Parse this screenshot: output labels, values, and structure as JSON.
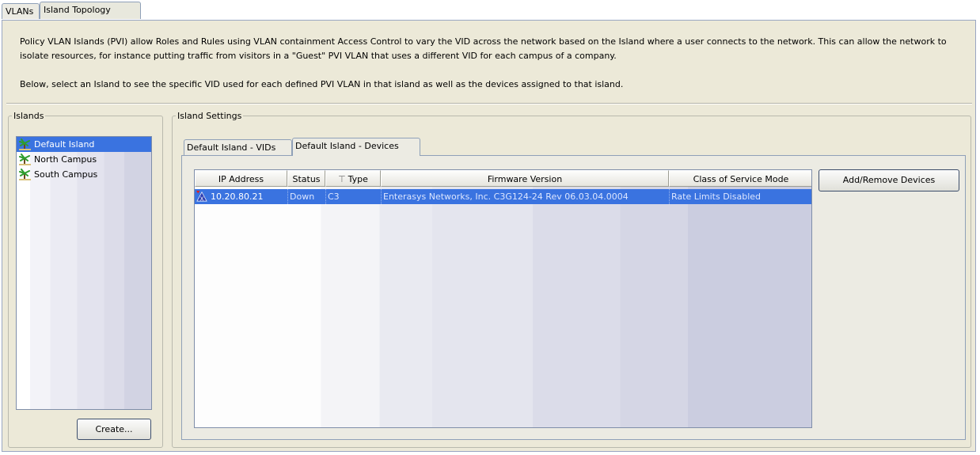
{
  "tabs": [
    {
      "label": "VLANs"
    },
    {
      "label": "Island Topology"
    }
  ],
  "description": {
    "line1": "Policy VLAN Islands (PVI) allow Roles and Rules using VLAN containment Access Control to vary the VID across the network based on the Island where a user connects to the network.  This can allow the network to isolate resources, for instance putting traffic from visitors in a \"Guest\" PVI VLAN that uses a different VID for each campus of a company.",
    "line2": "Below, select an Island to see the specific VID used for each defined PVI VLAN in that island as well as the devices assigned to that island."
  },
  "islands": {
    "title": "Islands",
    "items": [
      {
        "label": "Default Island",
        "icon": "palm-tree-icon"
      },
      {
        "label": "North Campus",
        "icon": "palm-tree-icon"
      },
      {
        "label": "South Campus",
        "icon": "palm-tree-icon"
      }
    ],
    "create_label": "Create..."
  },
  "settings": {
    "title": "Island Settings",
    "subtabs": [
      {
        "label": "Default Island - VIDs"
      },
      {
        "label": "Default Island - Devices"
      }
    ],
    "columns": [
      "IP Address",
      "Status",
      "Type",
      "Firmware Version",
      "Class of Service Mode"
    ],
    "rows": [
      {
        "ip": "10.20.80.21",
        "status": "Down",
        "type": "C3",
        "firmware": "Enterasys Networks, Inc. C3G124-24 Rev 06.03.04.0004",
        "cos_mode": "Rate Limits Disabled"
      }
    ],
    "add_remove_label": "Add/Remove Devices"
  },
  "colors": {
    "selection": "#3a73e0",
    "panel": "#ece9d8",
    "border": "#8fa0b8"
  }
}
